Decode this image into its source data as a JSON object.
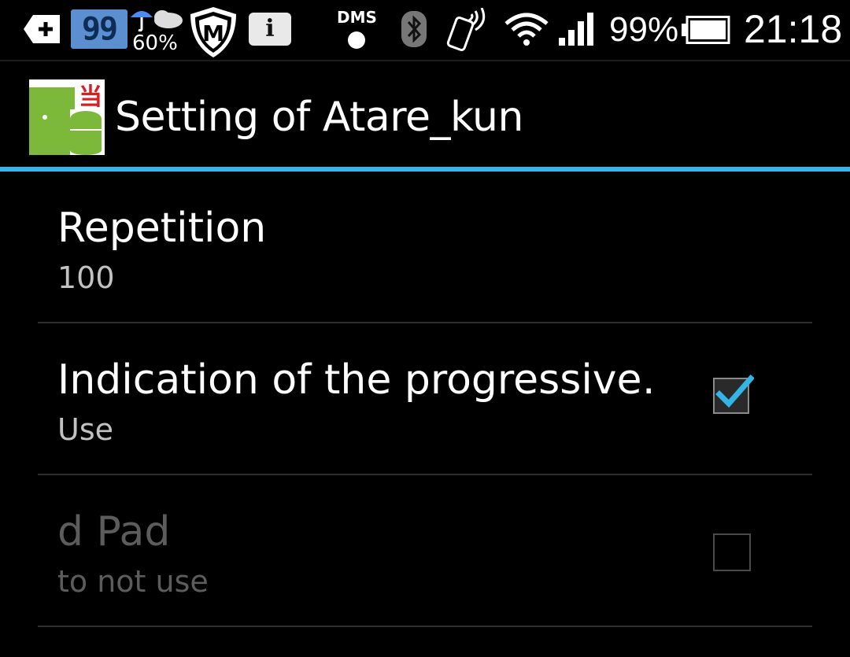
{
  "status_bar": {
    "battery_widget_value": "99",
    "weather_rain_chance": "60%",
    "shield_letter": "M",
    "info_letter": "i",
    "dms_label": "DMS",
    "battery_percent": "99%",
    "time": "21:18"
  },
  "action_bar": {
    "title": "Setting of Atare_kun",
    "icon_badge_char": "当"
  },
  "preferences": [
    {
      "title": "Repetition",
      "summary": "100",
      "has_checkbox": false,
      "enabled": true
    },
    {
      "title": "Indication of the progressive…",
      "summary": "Use",
      "has_checkbox": true,
      "checked": true,
      "enabled": true
    },
    {
      "title": "d Pad",
      "summary": "to not use",
      "has_checkbox": true,
      "checked": false,
      "enabled": false
    }
  ],
  "colors": {
    "accent": "#33b5e5",
    "background": "#000000",
    "summary_text": "#c2c2c2",
    "disabled_text": "#5c5c5c",
    "divider": "#2e2e2e"
  }
}
